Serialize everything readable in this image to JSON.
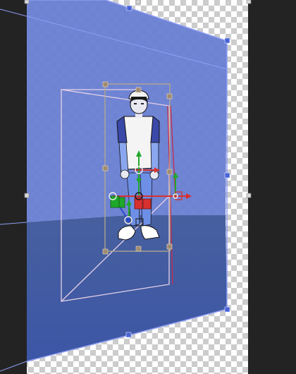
{
  "canvas": {
    "background": "#232323",
    "transparency_checker": [
      "#ffffff",
      "#cccccc"
    ],
    "plane_upper_color": "#6f84d6",
    "plane_lower_color": "#3f58a8",
    "plane_border_color": "#7d8df0",
    "handle_color": "#4a64d8",
    "transform_box_color": "#b8a88c",
    "perspective_frame_color": "#e6d2e6",
    "depth_edge_color": "#c62b48"
  },
  "figure": {
    "description_icon": "person-figure",
    "cap_color": "#f2f2f2",
    "shirt_color": "#f4f4f4",
    "sleeve_color": "#3a49a8",
    "skin_color": "#e8e8f2",
    "jeans_color": "#6d90e6",
    "shoe_color": "#ffffff"
  },
  "gizmo": {
    "x_axis_color": "#d8302e",
    "y_axis_color": "#1fa82a",
    "z_axis_color": "#2a48c8",
    "ring_color": "#f0f0f0"
  },
  "icons": {
    "transform_handle": "square-handle",
    "move_gizmo": "move-arrows-icon",
    "rotate_gizmo": "rotate-icon",
    "scale_gizmo": "scale-cubes-icon"
  }
}
